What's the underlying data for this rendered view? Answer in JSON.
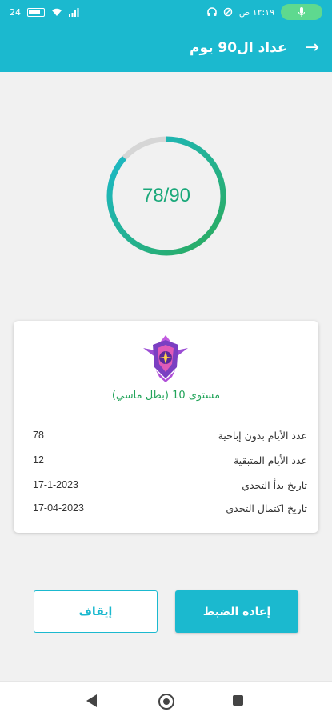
{
  "status_bar": {
    "battery_level": "24",
    "time": "١٢:١٩ ص"
  },
  "app_bar": {
    "title": "عداد ال90 يوم"
  },
  "progress": {
    "text": "78/90",
    "value": 78,
    "total": 90
  },
  "card": {
    "level": "مستوى 10 (بطل ماسي)",
    "rows": [
      {
        "label": "عدد الأيام بدون إباحية",
        "value": "78"
      },
      {
        "label": "عدد الأيام المتبقية",
        "value": "12"
      },
      {
        "label": "تاريخ بدأ التحدي",
        "value": "17-1-2023"
      },
      {
        "label": "تاريخ اكتمال التحدي",
        "value": "17-04-2023"
      }
    ]
  },
  "buttons": {
    "reset": "إعادة الضبط",
    "stop": "إيقاف"
  },
  "colors": {
    "primary": "#1bb9cf",
    "ring_start": "#1bb9cf",
    "ring_end": "#2bab5a",
    "ring_track": "#d6d6d6",
    "level_text": "#22a45a"
  }
}
